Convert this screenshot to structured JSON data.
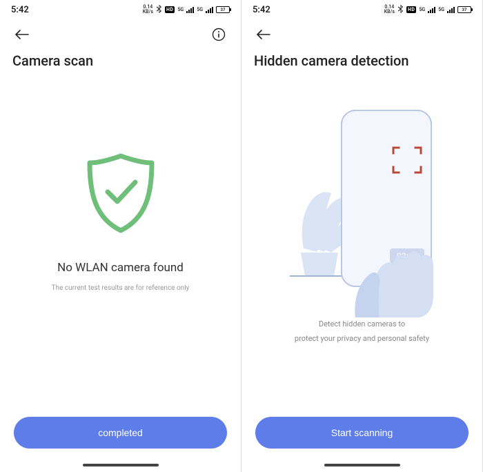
{
  "status": {
    "time": "5:42",
    "kbps": "0.14",
    "kbps_unit": "KB/s",
    "hd_label": "HD",
    "net_label": "5G",
    "battery": "37"
  },
  "left": {
    "page_title": "Camera scan",
    "result": "No WLAN camera found",
    "result_sub": "The current test results are for reference only",
    "button": "completed"
  },
  "right": {
    "page_title": "Hidden camera detection",
    "time_badge": "02:36",
    "detect_line1": "Detect hidden cameras to",
    "detect_line2": "protect your privacy and personal safety",
    "button": "Start scanning"
  }
}
